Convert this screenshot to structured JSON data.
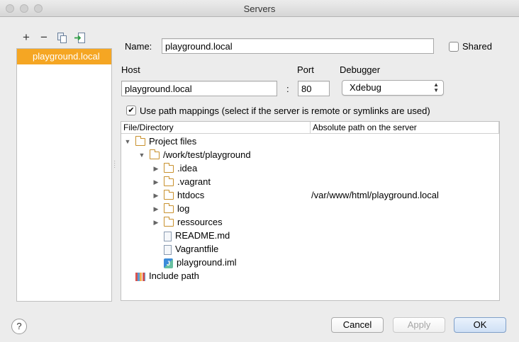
{
  "window": {
    "title": "Servers"
  },
  "toolbar": {
    "add": "+",
    "remove": "−"
  },
  "servers": [
    {
      "label": "playground.local"
    }
  ],
  "form": {
    "name_label": "Name:",
    "name_value": "playground.local",
    "shared_label": "Shared",
    "shared_checked": false,
    "host_label": "Host",
    "host_value": "playground.local",
    "port_label": "Port",
    "port_sep": ":",
    "port_value": "80",
    "debugger_label": "Debugger",
    "debugger_value": "Xdebug",
    "mappings_label": "Use path mappings (select if the server is remote or symlinks are used)",
    "mappings_checked": true
  },
  "tree": {
    "col_file": "File/Directory",
    "col_abs": "Absolute path on the server",
    "rows": [
      {
        "label": "Project files",
        "icon": "folder",
        "expanded": true
      },
      {
        "label": "/work/test/playground",
        "icon": "folder",
        "expanded": true
      },
      {
        "label": ".idea",
        "icon": "folder"
      },
      {
        "label": ".vagrant",
        "icon": "folder"
      },
      {
        "label": "htdocs",
        "icon": "folder",
        "abs": "/var/www/html/playground.local"
      },
      {
        "label": "log",
        "icon": "folder"
      },
      {
        "label": "ressources",
        "icon": "folder"
      },
      {
        "label": "README.md",
        "icon": "file"
      },
      {
        "label": "Vagrantfile",
        "icon": "file"
      },
      {
        "label": "playground.iml",
        "icon": "iml"
      },
      {
        "label": "Include path",
        "icon": "library"
      }
    ]
  },
  "footer": {
    "help": "?",
    "cancel": "Cancel",
    "apply": "Apply",
    "ok": "OK"
  }
}
